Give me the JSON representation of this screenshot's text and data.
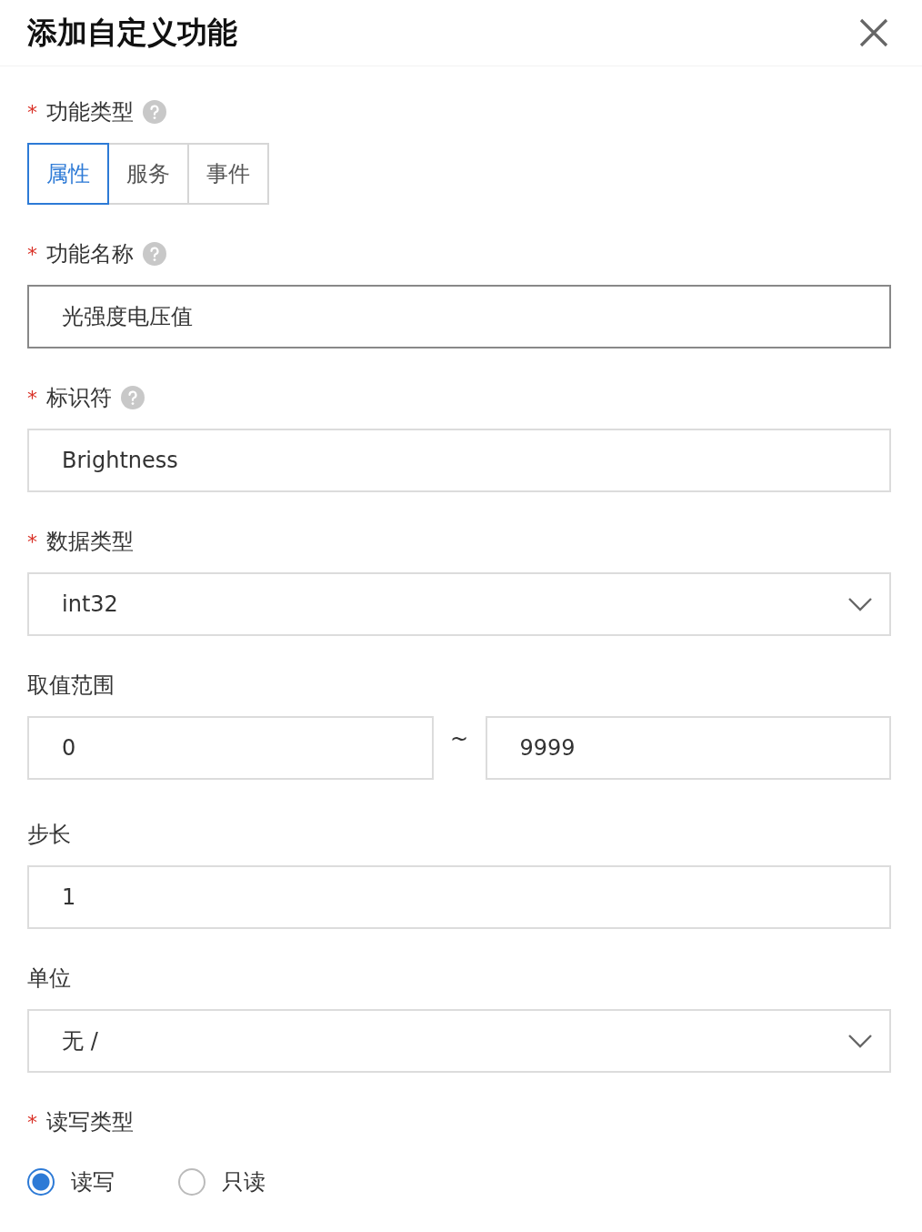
{
  "dialog": {
    "title": "添加自定义功能"
  },
  "fields": [
    {
      "kind": "segmented",
      "label": "功能类型",
      "required_mark": "*",
      "help": true,
      "options": [
        {
          "label": "属性",
          "selected": true
        },
        {
          "label": "服务",
          "selected": false
        },
        {
          "label": "事件",
          "selected": false
        }
      ]
    },
    {
      "kind": "input",
      "label": "功能名称",
      "required_mark": "*",
      "help": true,
      "value": "光强度电压值",
      "focused": true
    },
    {
      "kind": "input",
      "label": "标识符",
      "required_mark": "*",
      "help": true,
      "value": "Brightness",
      "focused": false
    },
    {
      "kind": "select",
      "label": "数据类型",
      "required_mark": "*",
      "help": false,
      "value": "int32"
    },
    {
      "kind": "range",
      "label": "取值范围",
      "help": false,
      "min": "0",
      "separator": "~",
      "max": "9999"
    },
    {
      "kind": "input",
      "label": "步长",
      "help": false,
      "value": "1",
      "focused": false
    },
    {
      "kind": "select",
      "label": "单位",
      "help": false,
      "value": "无 /"
    },
    {
      "kind": "radio",
      "label": "读写类型",
      "required_mark": "*",
      "help": false,
      "options": [
        {
          "label": "读写",
          "selected": true
        },
        {
          "label": "只读",
          "selected": false
        }
      ]
    }
  ]
}
